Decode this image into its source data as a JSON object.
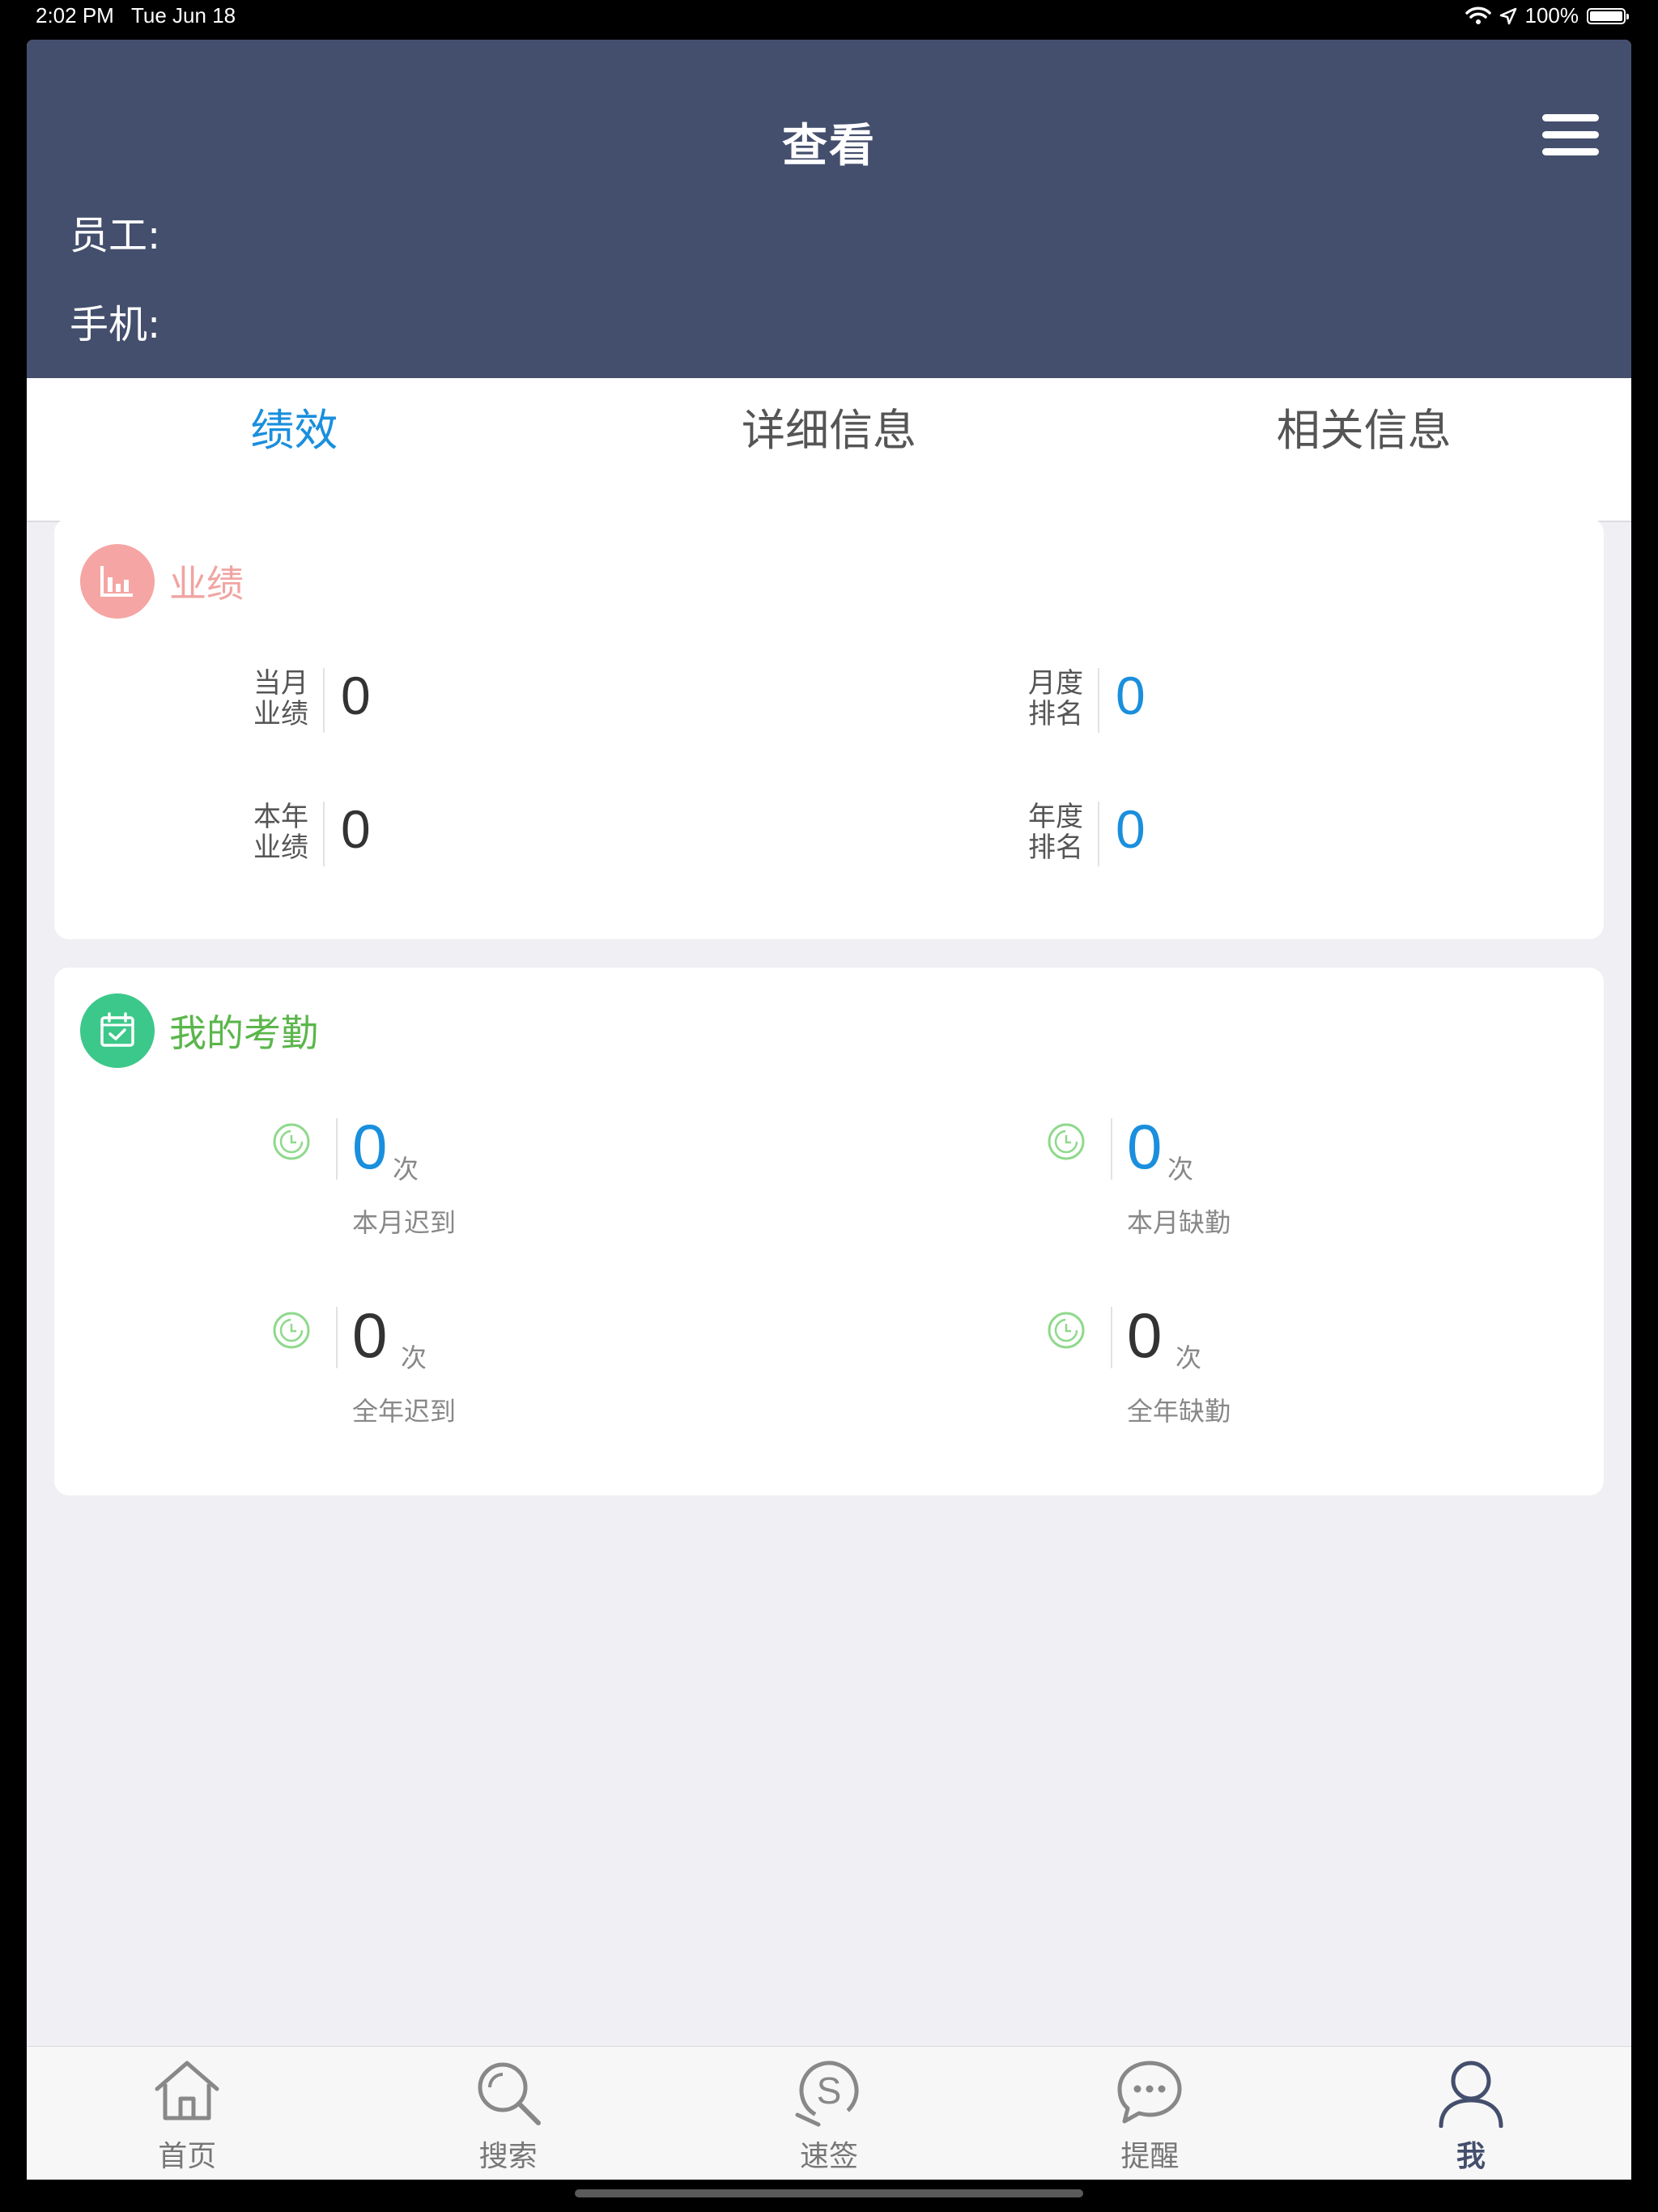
{
  "status_bar": {
    "time": "2:02 PM",
    "date": "Tue Jun 18",
    "battery": "100%"
  },
  "header": {
    "title": "查看",
    "employee_label": "员工:",
    "phone_label": "手机:"
  },
  "tabs": [
    {
      "label": "绩效",
      "active": true
    },
    {
      "label": "详细信息",
      "active": false
    },
    {
      "label": "相关信息",
      "active": false
    }
  ],
  "performance": {
    "title": "业绩",
    "icon": "bar-chart-icon",
    "accent": "#f5a5a3",
    "monthly_perf": {
      "label_line1": "当月",
      "label_line2": "业绩",
      "value": "0"
    },
    "monthly_rank": {
      "label_line1": "月度",
      "label_line2": "排名",
      "value": "0"
    },
    "yearly_perf": {
      "label_line1": "本年",
      "label_line2": "业绩",
      "value": "0"
    },
    "yearly_rank": {
      "label_line1": "年度",
      "label_line2": "排名",
      "value": "0"
    }
  },
  "attendance": {
    "title": "我的考勤",
    "icon": "calendar-check-icon",
    "accent": "#3cc88a",
    "title_color": "#5bb64b",
    "month_late": {
      "value": "0",
      "unit": "次",
      "caption": "本月迟到"
    },
    "month_absent": {
      "value": "0",
      "unit": "次",
      "caption": "本月缺勤"
    },
    "year_late": {
      "value": "0",
      "unit": "次",
      "caption": "全年迟到"
    },
    "year_absent": {
      "value": "0",
      "unit": "次",
      "caption": "全年缺勤"
    }
  },
  "tab_bar": [
    {
      "label": "首页",
      "icon": "home-icon"
    },
    {
      "label": "搜索",
      "icon": "search-icon"
    },
    {
      "label": "速签",
      "icon": "quick-sign-icon"
    },
    {
      "label": "提醒",
      "icon": "chat-bubble-icon"
    },
    {
      "label": "我",
      "icon": "user-icon",
      "active": true
    }
  ]
}
